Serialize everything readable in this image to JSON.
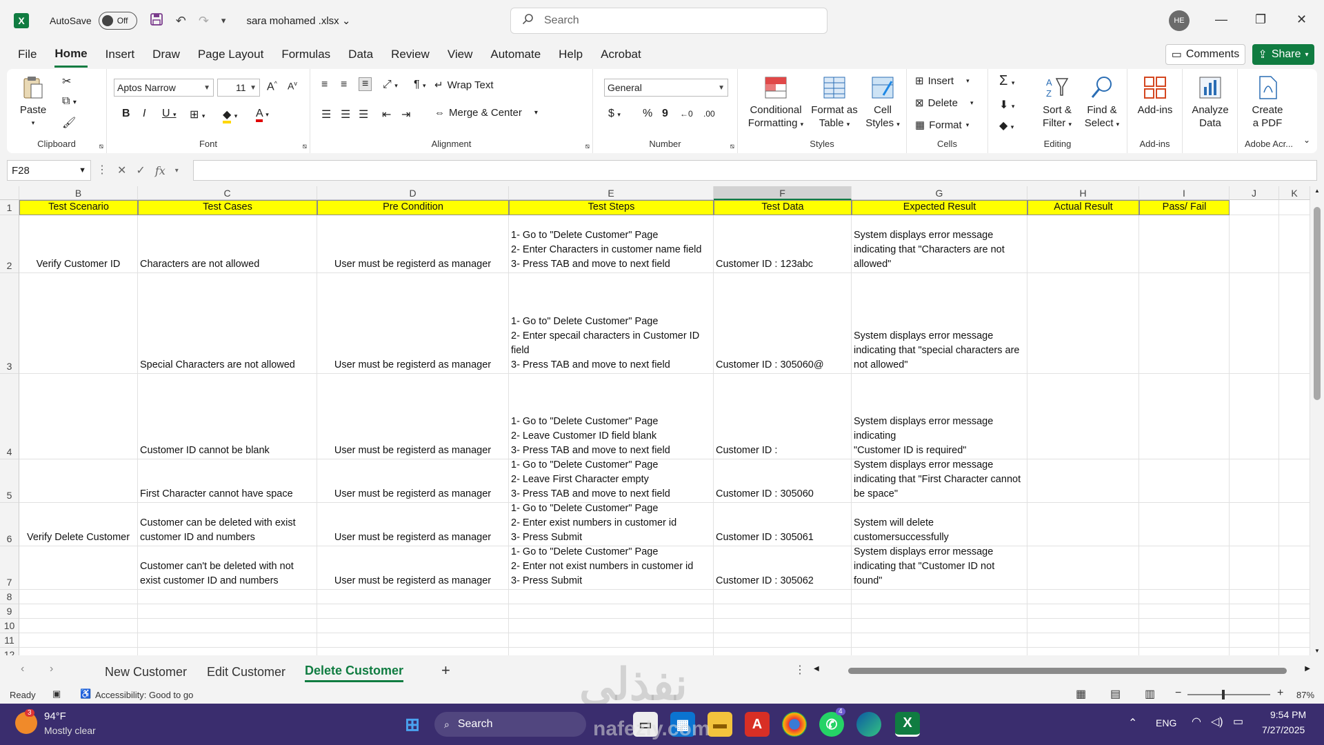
{
  "titlebar": {
    "autosave_label": "AutoSave",
    "autosave_state": "Off",
    "doc_name": "sara mohamed .xlsx",
    "search_placeholder": "Search",
    "avatar_initials": "HE"
  },
  "menu": {
    "tabs": [
      "File",
      "Home",
      "Insert",
      "Draw",
      "Page Layout",
      "Formulas",
      "Data",
      "Review",
      "View",
      "Automate",
      "Help",
      "Acrobat"
    ],
    "comments": "Comments",
    "share": "Share"
  },
  "ribbon": {
    "clipboard": {
      "paste": "Paste",
      "label": "Clipboard"
    },
    "font": {
      "name": "Aptos Narrow",
      "size": "11",
      "label": "Font"
    },
    "alignment": {
      "wrap": "Wrap Text",
      "merge": "Merge & Center",
      "label": "Alignment"
    },
    "number": {
      "format": "General",
      "label": "Number"
    },
    "styles": {
      "cond_1": "Conditional",
      "cond_2": "Formatting",
      "fmt_1": "Format as",
      "fmt_2": "Table",
      "cell_1": "Cell",
      "cell_2": "Styles",
      "label": "Styles"
    },
    "cells": {
      "insert": "Insert",
      "delete": "Delete",
      "format": "Format",
      "label": "Cells"
    },
    "editing": {
      "sort_1": "Sort &",
      "sort_2": "Filter",
      "find_1": "Find &",
      "find_2": "Select",
      "label": "Editing"
    },
    "addins": {
      "btn": "Add-ins",
      "label": "Add-ins"
    },
    "analyze": {
      "l1": "Analyze",
      "l2": "Data"
    },
    "pdf": {
      "l1": "Create",
      "l2": "a PDF",
      "label": "Adobe Acr..."
    }
  },
  "formula_bar": {
    "name_box": "F28",
    "fx": "fx",
    "value": ""
  },
  "sheet": {
    "column_letters": [
      "B",
      "C",
      "D",
      "E",
      "F",
      "G",
      "H",
      "I",
      "J",
      "K"
    ],
    "selected_column": "F",
    "headers": [
      "Test Scenario",
      "Test Cases",
      "Pre Condition",
      "Test Steps",
      "Test Data",
      "Expected Result",
      "Actual Result",
      "Pass/ Fail"
    ],
    "rows": [
      {
        "num": "2",
        "cells": [
          "Verify Customer ID",
          "Characters are not allowed",
          "User must be registerd as manager",
          "1- Go to \"Delete Customer\" Page\n2- Enter Characters in customer name field\n3- Press TAB and move to next field",
          "Customer ID : 123abc",
          "System displays error message\nindicating that \"Characters are not\nallowed\"",
          "",
          ""
        ]
      },
      {
        "num": "3",
        "cells": [
          "",
          "Special Characters are not allowed",
          "User must be registerd as manager",
          "1- Go to\" Delete Customer\" Page\n2- Enter specail characters in Customer ID\nfield\n3- Press TAB and move to next field",
          "Customer ID : 305060@",
          "System displays error message\nindicating that \"special characters are\nnot allowed\"",
          "",
          ""
        ]
      },
      {
        "num": "4",
        "cells": [
          "",
          "Customer ID cannot be blank",
          "User must be registerd as manager",
          "1- Go to \"Delete Customer\" Page\n2- Leave Customer ID field blank\n3- Press TAB and move to next field",
          "Customer ID :",
          "System displays error message\nindicating\n\"Customer ID is required\"",
          "",
          ""
        ]
      },
      {
        "num": "5",
        "cells": [
          "",
          "First Character cannot have space",
          "User must be registerd as manager",
          "1- Go to \"Delete Customer\" Page\n2- Leave First Character empty\n3- Press TAB and move to next field",
          "Customer ID :     305060",
          "System displays error message\nindicating that \"First Character cannot\nbe space\"",
          "",
          ""
        ]
      },
      {
        "num": "6",
        "cells": [
          "Verify Delete Customer",
          "Customer can be deleted with exist\ncustomer ID and numbers",
          "User must be registerd as manager",
          "1- Go to \"Delete Customer\" Page\n2- Enter exist numbers in customer id\n3- Press Submit",
          "Customer ID :     305061",
          "System will delete\ncustomersuccessfully",
          "",
          ""
        ]
      },
      {
        "num": "7",
        "cells": [
          "",
          "Customer can't be deleted with not\nexist customer ID and numbers",
          "User must be registerd as manager",
          "1- Go to \"Delete Customer\" Page\n2- Enter not exist numbers in customer id\n3- Press Submit",
          "Customer ID :     305062",
          "System displays error message\nindicating that \"Customer ID not found\"",
          "",
          ""
        ]
      }
    ],
    "empty_rows": [
      "8",
      "9",
      "10",
      "11",
      "12"
    ]
  },
  "sheet_tabs": [
    "New Customer",
    "Edit Customer",
    "Delete Customer"
  ],
  "active_sheet": "Delete Customer",
  "status": {
    "ready": "Ready",
    "accessibility": "Accessibility: Good to go",
    "zoom": "87%"
  },
  "taskbar": {
    "weather_temp": "94°F",
    "weather_desc": "Mostly clear",
    "weather_badge": "3",
    "search": "Search",
    "lang": "ENG",
    "time": "9:54 PM",
    "date": "7/27/2025",
    "whatsapp_badge": "4"
  },
  "watermark": {
    "arabic": "نفذلي",
    "latin": "nafezly.com"
  },
  "colors": {
    "accent": "#107c41",
    "header_fill": "#ffff00",
    "taskbar": "#3a2d6e"
  }
}
